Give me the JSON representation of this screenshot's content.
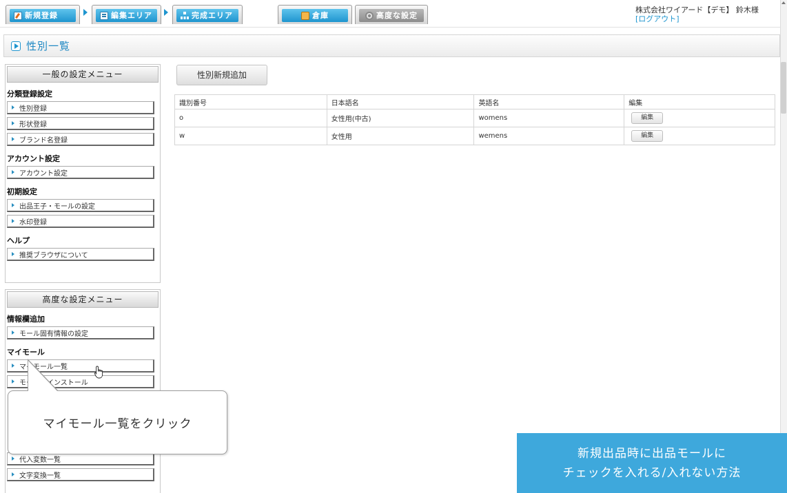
{
  "nav": {
    "tabs": [
      {
        "label": "新規登録",
        "icon": "edit-icon"
      },
      {
        "label": "編集エリア",
        "icon": "list-icon"
      },
      {
        "label": "完成エリア",
        "icon": "tree-icon"
      },
      {
        "label": "倉庫",
        "icon": "box-icon"
      },
      {
        "label": "高度な設定",
        "icon": "gear-icon"
      }
    ],
    "user": "株式会社ワイアード【デモ】 鈴木様",
    "logout": "[ログアウト]"
  },
  "page": {
    "title": "性別一覧"
  },
  "sidebar": {
    "general": {
      "title": "一般の設定メニュー",
      "groups": [
        {
          "heading": "分類登録設定",
          "items": [
            "性別登録",
            "形状登録",
            "ブランド名登録"
          ]
        },
        {
          "heading": "アカウント設定",
          "items": [
            "アカウント設定"
          ]
        },
        {
          "heading": "初期設定",
          "items": [
            "出品王子・モールの設定",
            "水印登録"
          ]
        },
        {
          "heading": "ヘルプ",
          "items": [
            "推奨ブラウザについて"
          ]
        }
      ]
    },
    "advanced": {
      "title": "高度な設定メニュー",
      "groups": [
        {
          "heading": "情報欄追加",
          "items": [
            "モール固有情報の設定"
          ]
        },
        {
          "heading": "マイモール",
          "items": [
            "マイモール一覧",
            "モールをインストール"
          ]
        }
      ],
      "bottom_items": [
        "代入変数一覧",
        "文字変換一覧"
      ]
    }
  },
  "main": {
    "add_button": "性別新規追加",
    "table": {
      "headers": [
        "識別番号",
        "日本語名",
        "英語名",
        "編集"
      ],
      "rows": [
        {
          "id": "o",
          "ja": "女性用(中古)",
          "en": "womens",
          "edit": "編集"
        },
        {
          "id": "w",
          "ja": "女性用",
          "en": "wemens",
          "edit": "編集"
        }
      ]
    }
  },
  "callout": {
    "text": "マイモール一覧をクリック"
  },
  "banner": {
    "line1": "新規出品時に出品モールに",
    "line2": "チェックを入れる/入れない方法"
  },
  "colors": {
    "accent": "#1e95cf",
    "banner": "#3ea8dc"
  }
}
